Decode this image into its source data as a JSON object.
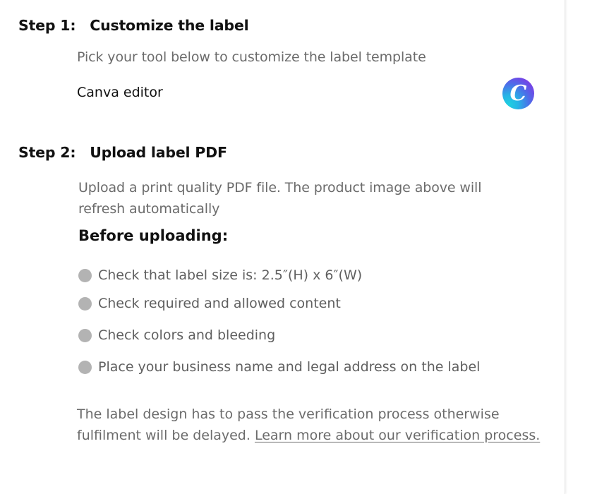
{
  "step1": {
    "number": "Step 1:",
    "title": "Customize the label",
    "description": "Pick your tool below to customize the label template",
    "tool_name": "Canva editor",
    "tool_logo_letter": "C",
    "tool_logo_icon": "canva-logo-icon"
  },
  "step2": {
    "number": "Step 2:",
    "title": "Upload label PDF",
    "description": "Upload a print quality PDF file. The product image above will refresh automatically",
    "before_heading": "Before uploading:",
    "checklist": [
      "Check that label size is: 2.5″(H) x 6″(W)",
      "Check required and allowed content",
      "Check colors and bleeding",
      "Place your business name and legal address on the label"
    ],
    "note": "The label design has to pass the verification process otherwise fulfilment will be delayed. ",
    "learn_more_link": "Learn more about our verification process."
  },
  "colors": {
    "bullet": "#b3b3b3",
    "body_text": "#6b6b6b",
    "heading_text": "#111111"
  }
}
